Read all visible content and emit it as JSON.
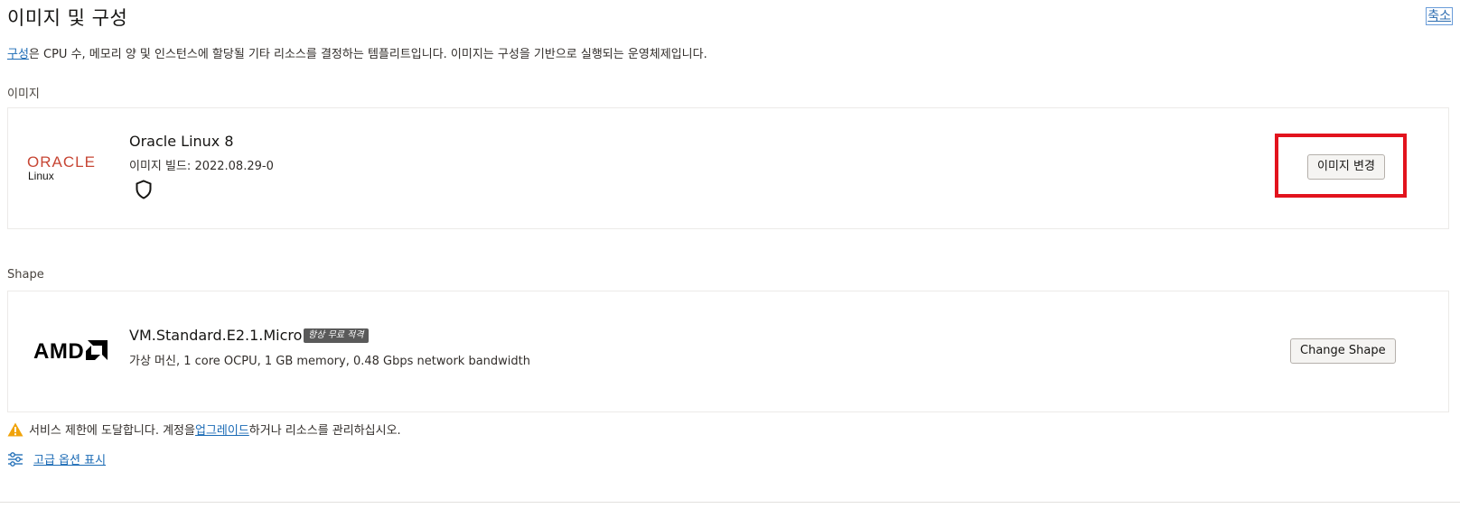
{
  "header": {
    "title": "이미지 및 구성",
    "collapse_label": "축소"
  },
  "intro": {
    "link_text": "구성",
    "text": "은 CPU 수, 메모리 양 및 인스턴스에 할당될 기타 리소스를 결정하는 템플리트입니다. 이미지는 구성을 기반으로 실행되는 운영체제입니다."
  },
  "image_section": {
    "label": "이미지",
    "logo_word": "ORACLE",
    "logo_sub": "Linux",
    "name": "Oracle Linux 8",
    "build": "이미지 빌드: 2022.08.29-0",
    "change_button": "이미지 변경",
    "shield_icon": "shield-icon"
  },
  "shape_section": {
    "label": "Shape",
    "logo_word": "AMD",
    "name": "VM.Standard.E2.1.Micro",
    "badge": "항상 무료 적격",
    "details": "가상 머신, 1 core OCPU, 1 GB memory, 0.48 Gbps network bandwidth",
    "change_button": "Change Shape"
  },
  "warning": {
    "icon": "warning-icon",
    "text_before": "서비스 제한에 도달합니다. 계정을 ",
    "link_text": "업그레이드",
    "text_after": "하거나 리소스를 관리하십시오."
  },
  "advanced": {
    "icon": "sliders-icon",
    "label": "고급 옵션 표시"
  },
  "colors": {
    "oracle_red": "#c74634",
    "highlight_red": "#e2131d",
    "link_blue": "#1a6ab5",
    "warning_yellow": "#f0a30a"
  }
}
